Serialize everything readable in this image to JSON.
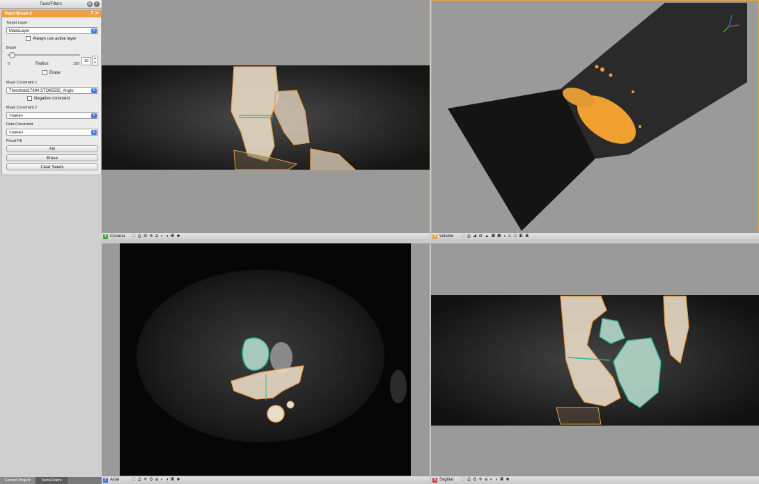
{
  "tools_panel": {
    "title": "Tools/Filters",
    "paint_brush": {
      "header": "Paint Brush 3",
      "target_layer_label": "Target Layer",
      "target_layer_value": "MaskLayer",
      "always_use_active_layer": "Always use active layer",
      "brush_label": "Brush",
      "slider_min": "0",
      "slider_max": "150",
      "radius_label": "Radius",
      "radius_value": "10",
      "erase_checkbox": "Erase",
      "mask_constraint_1_label": "Mask Constraint 1",
      "mask_constraint_1_value": "Threshold17694.STO65535_Angio",
      "negative_constraint": "Negative constraint",
      "mask_constraint_2_label": "Mask Constraint 2",
      "mask_constraint_2_value": "<none>",
      "data_constraint_label": "Data Constraint",
      "data_constraint_value": "<none>",
      "flood_fill_label": "Flood Fill",
      "fill_button": "Fill",
      "erase_button": "Erase",
      "clear_seeds_button": "Clear Seeds"
    },
    "bottom_tabs": [
      "Current Project",
      "Tools/Filters"
    ]
  },
  "viewports": {
    "coronal": {
      "letter": "Y",
      "name": "Coronal",
      "letter_color": "#3aa63a"
    },
    "volume": {
      "letter": "V",
      "name": "Volume",
      "letter_color": "#e0a040"
    },
    "axial": {
      "letter": "Z",
      "name": "Axial",
      "letter_color": "#3a6ad0"
    },
    "sagittal": {
      "letter": "X",
      "name": "Sagittal",
      "letter_color": "#d03a3a"
    }
  },
  "colors": {
    "accent": "#f0a040",
    "mask_orange": "#e8a04a",
    "segment_teal": "#2fb895"
  }
}
